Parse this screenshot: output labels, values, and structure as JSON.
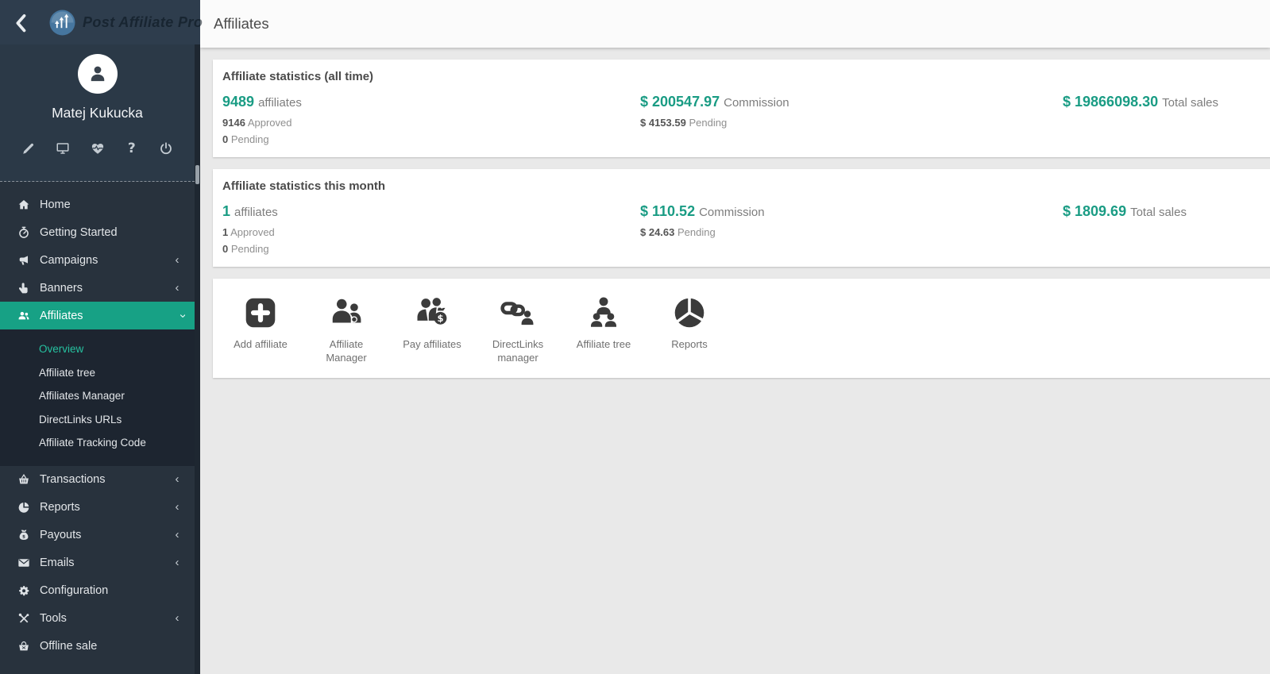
{
  "brand": {
    "app_name": "Post Affiliate Pro"
  },
  "user": {
    "name": "Matej Kukucka",
    "toolbar": [
      {
        "icon": "pencil-icon"
      },
      {
        "icon": "monitor-icon"
      },
      {
        "icon": "heartbeat-icon"
      },
      {
        "icon": "help-icon"
      },
      {
        "icon": "power-icon"
      }
    ]
  },
  "header": {
    "title": "Affiliates"
  },
  "sidebar": {
    "items": [
      {
        "label": "Home",
        "icon": "home-icon"
      },
      {
        "label": "Getting Started",
        "icon": "stopwatch-icon"
      },
      {
        "label": "Campaigns",
        "icon": "megaphone-icon",
        "chevron": "collapsed"
      },
      {
        "label": "Banners",
        "icon": "hand-pointer-icon",
        "chevron": "collapsed"
      },
      {
        "label": "Affiliates",
        "icon": "users-icon",
        "chevron": "expanded",
        "active": true
      },
      {
        "label": "Transactions",
        "icon": "basket-icon",
        "chevron": "collapsed"
      },
      {
        "label": "Reports",
        "icon": "pie-chart-icon",
        "chevron": "collapsed"
      },
      {
        "label": "Payouts",
        "icon": "money-bag-icon",
        "chevron": "collapsed"
      },
      {
        "label": "Emails",
        "icon": "envelope-icon",
        "chevron": "collapsed"
      },
      {
        "label": "Configuration",
        "icon": "gear-icon"
      },
      {
        "label": "Tools",
        "icon": "tools-icon",
        "chevron": "collapsed"
      },
      {
        "label": "Offline sale",
        "icon": "shopping-basket-icon"
      }
    ],
    "affiliates_submenu": [
      {
        "label": "Overview",
        "active": true
      },
      {
        "label": "Affiliate tree"
      },
      {
        "label": "Affiliates Manager"
      },
      {
        "label": "DirectLinks URLs"
      },
      {
        "label": "Affiliate Tracking Code"
      }
    ]
  },
  "stats_cards": [
    {
      "title": "Affiliate statistics (all time)",
      "affiliates": {
        "value": "9489",
        "label": "affiliates"
      },
      "approved": {
        "value": "9146",
        "label": "Approved"
      },
      "pending": {
        "value": "0",
        "label": "Pending"
      },
      "commission": {
        "value": "$ 200547.97",
        "label": "Commission"
      },
      "commission_pending": {
        "value": "$ 4153.59",
        "label": "Pending"
      },
      "total_sales": {
        "value": "$ 19866098.30",
        "label": "Total sales"
      }
    },
    {
      "title": "Affiliate statistics this month",
      "affiliates": {
        "value": "1",
        "label": "affiliates"
      },
      "approved": {
        "value": "1",
        "label": "Approved"
      },
      "pending": {
        "value": "0",
        "label": "Pending"
      },
      "commission": {
        "value": "$ 110.52",
        "label": "Commission"
      },
      "commission_pending": {
        "value": "$ 24.63",
        "label": "Pending"
      },
      "total_sales": {
        "value": "$ 1809.69",
        "label": "Total sales"
      }
    }
  ],
  "quick_actions": [
    {
      "label": "Add affiliate",
      "icon": "add-affiliate-icon"
    },
    {
      "label": "Affiliate Manager",
      "icon": "affiliate-manager-icon"
    },
    {
      "label": "Pay affiliates",
      "icon": "pay-affiliates-icon"
    },
    {
      "label": "DirectLinks manager",
      "icon": "directlinks-manager-icon"
    },
    {
      "label": "Affiliate tree",
      "icon": "affiliate-tree-icon"
    },
    {
      "label": "Reports",
      "icon": "reports-icon"
    }
  ],
  "colors": {
    "accent_green": "#17a185",
    "submenu_active_green": "#26c2a0",
    "sidebar_bg": "#28323d",
    "topbar_bg": "#2e3d4d",
    "content_bg": "#e9e9e9"
  }
}
